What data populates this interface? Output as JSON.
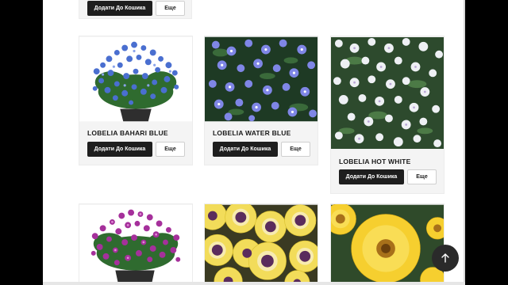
{
  "buttons": {
    "add_to_cart": "Додати До Кошика",
    "more": "Еще"
  },
  "products": [
    {
      "name": "LOBELIA BAHARI BLUE"
    },
    {
      "name": "LOBELIA WATER BLUE"
    },
    {
      "name": "LOBELIA HOT WHITE"
    }
  ],
  "colors": {
    "button_dark": "#1e1e1e",
    "card_bg": "#f4f4f4",
    "scroll_top_bg": "#2a2a2a"
  },
  "icons": {
    "scroll_top": "arrow-up-icon"
  }
}
